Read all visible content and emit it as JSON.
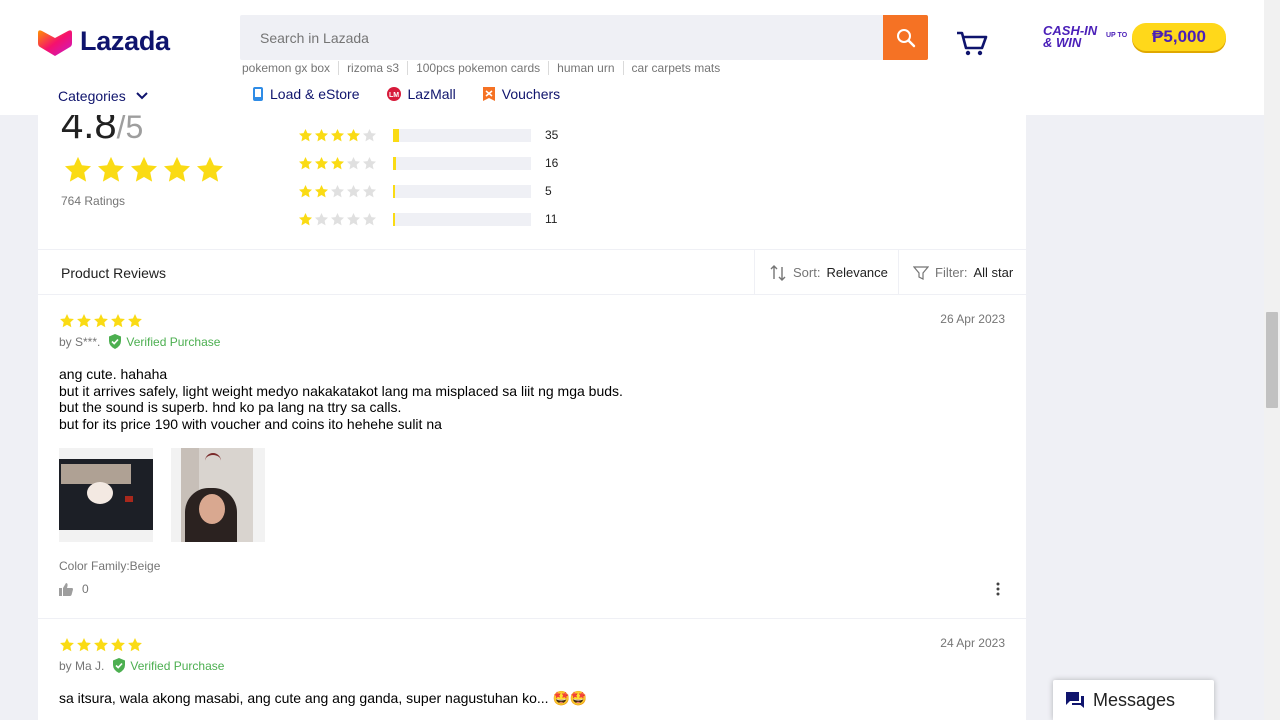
{
  "header": {
    "logo_text": "Lazada",
    "search_placeholder": "Search in Lazada",
    "suggestions": [
      "pokemon gx box",
      "rizoma s3",
      "100pcs pokemon cards",
      "human urn",
      "car carpets mats"
    ],
    "categories_label": "Categories",
    "quicklinks": [
      {
        "label": "Load & eStore",
        "icon": "phone-icon"
      },
      {
        "label": "LazMall",
        "icon": "lazmall-icon"
      },
      {
        "label": "Vouchers",
        "icon": "voucher-icon"
      }
    ],
    "promo": {
      "line1": "CASH-IN",
      "line2": "& WIN",
      "upto": "UP TO",
      "amount": "₱5,000"
    }
  },
  "rating_summary": {
    "score": "4.8",
    "max": "/5",
    "average_stars": 5,
    "ratings_count": "764 Ratings",
    "distribution": [
      {
        "stars": 4,
        "count": "35",
        "fraction": 0.046
      },
      {
        "stars": 3,
        "count": "16",
        "fraction": 0.021
      },
      {
        "stars": 2,
        "count": "5",
        "fraction": 0.007
      },
      {
        "stars": 1,
        "count": "11",
        "fraction": 0.014
      }
    ]
  },
  "reviews_section": {
    "title": "Product Reviews",
    "sort_label": "Sort:",
    "sort_value": "Relevance",
    "filter_label": "Filter:",
    "filter_value": "All star"
  },
  "reviews": [
    {
      "stars": 5,
      "date": "26 Apr 2023",
      "author": "by S***.",
      "verified": "Verified Purchase",
      "text_lines": [
        "ang cute. hahaha",
        "but it arrives safely, light weight medyo nakakatakot lang ma misplaced sa liit ng mga buds.",
        "but the sound is superb. hnd ko pa lang na ttry sa calls.",
        "but for its price 190 with voucher and coins ito hehehe sulit na"
      ],
      "sku": "Color Family:Beige",
      "likes": "0"
    },
    {
      "stars": 5,
      "date": "24 Apr 2023",
      "author": "by Ma J.",
      "verified": "Verified Purchase",
      "text_lines": [
        "sa itsura, wala akong masabi, ang cute ang ang ganda, super nagustuhan ko... 🤩🤩"
      ]
    }
  ],
  "messages_label": "Messages",
  "colors": {
    "accent": "#f57224",
    "star": "#fadb14",
    "verified": "#4caf50",
    "navy": "#0f146d"
  }
}
